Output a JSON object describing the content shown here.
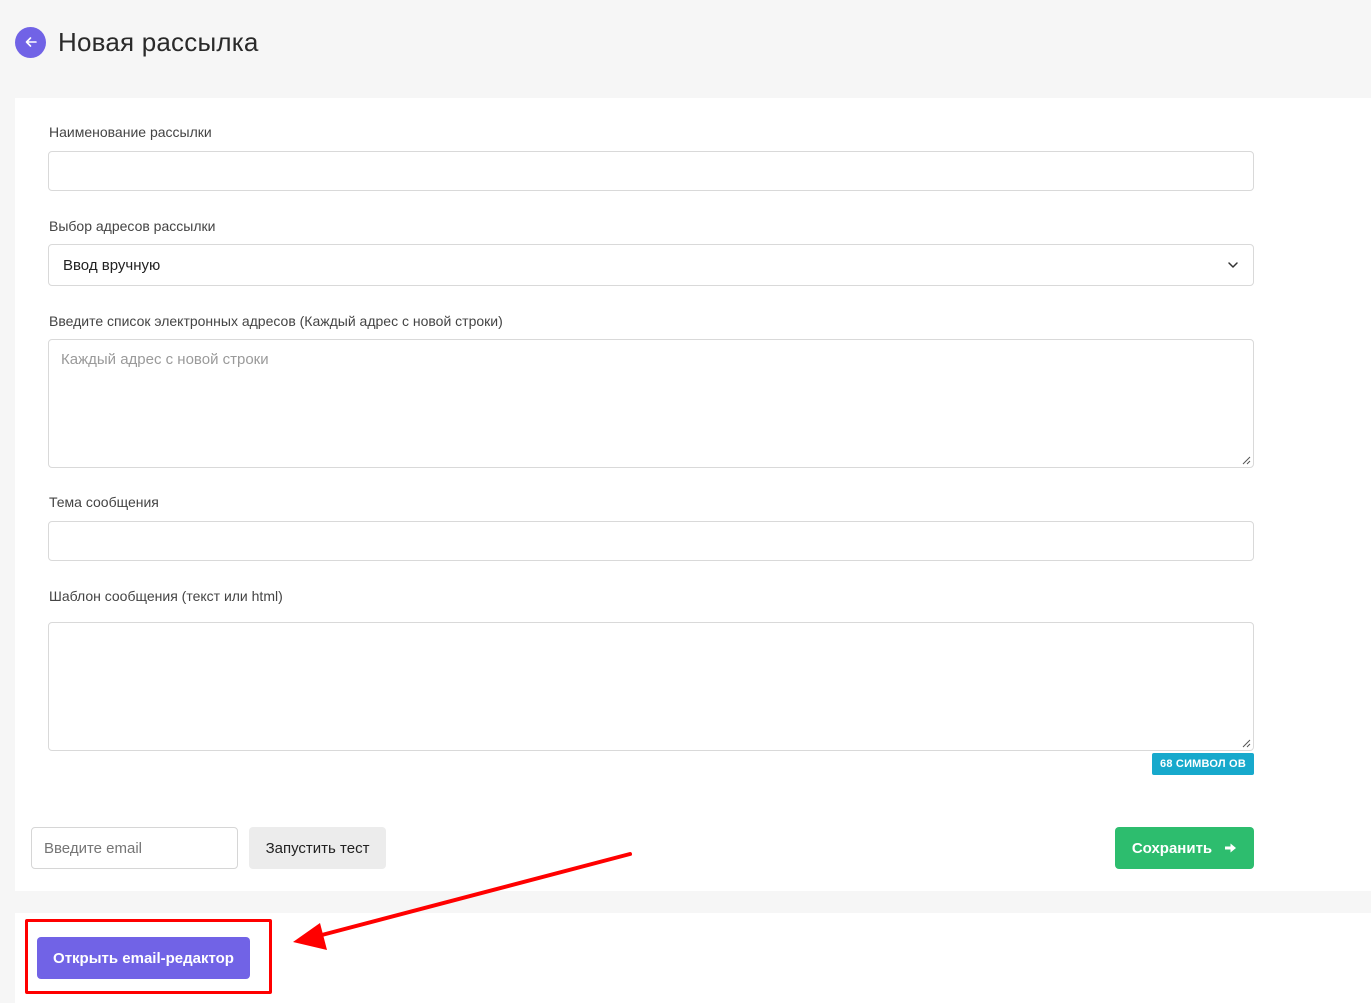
{
  "header": {
    "title": "Новая рассылка"
  },
  "form": {
    "name_label": "Наименование рассылки",
    "name_value": "",
    "addresses_label": "Выбор адресов рассылки",
    "addresses_selected": "Ввод вручную",
    "emails_label": "Введите список электронных адресов (Каждый адрес с новой строки)",
    "emails_placeholder": "Каждый адрес с новой строки",
    "subject_label": "Тема сообщения",
    "subject_value": "",
    "template_label": "Шаблон сообщения (текст или html)",
    "template_value": "",
    "char_count": "68 СИМВОЛ ОВ"
  },
  "actions": {
    "test_email_placeholder": "Введите email",
    "run_test_label": "Запустить тест",
    "save_label": "Сохранить",
    "open_editor_label": "Открыть email-редактор"
  },
  "colors": {
    "accent": "#7163e6",
    "success": "#2dbd6e",
    "badge": "#17a9cc",
    "annotation": "#ff0000"
  }
}
